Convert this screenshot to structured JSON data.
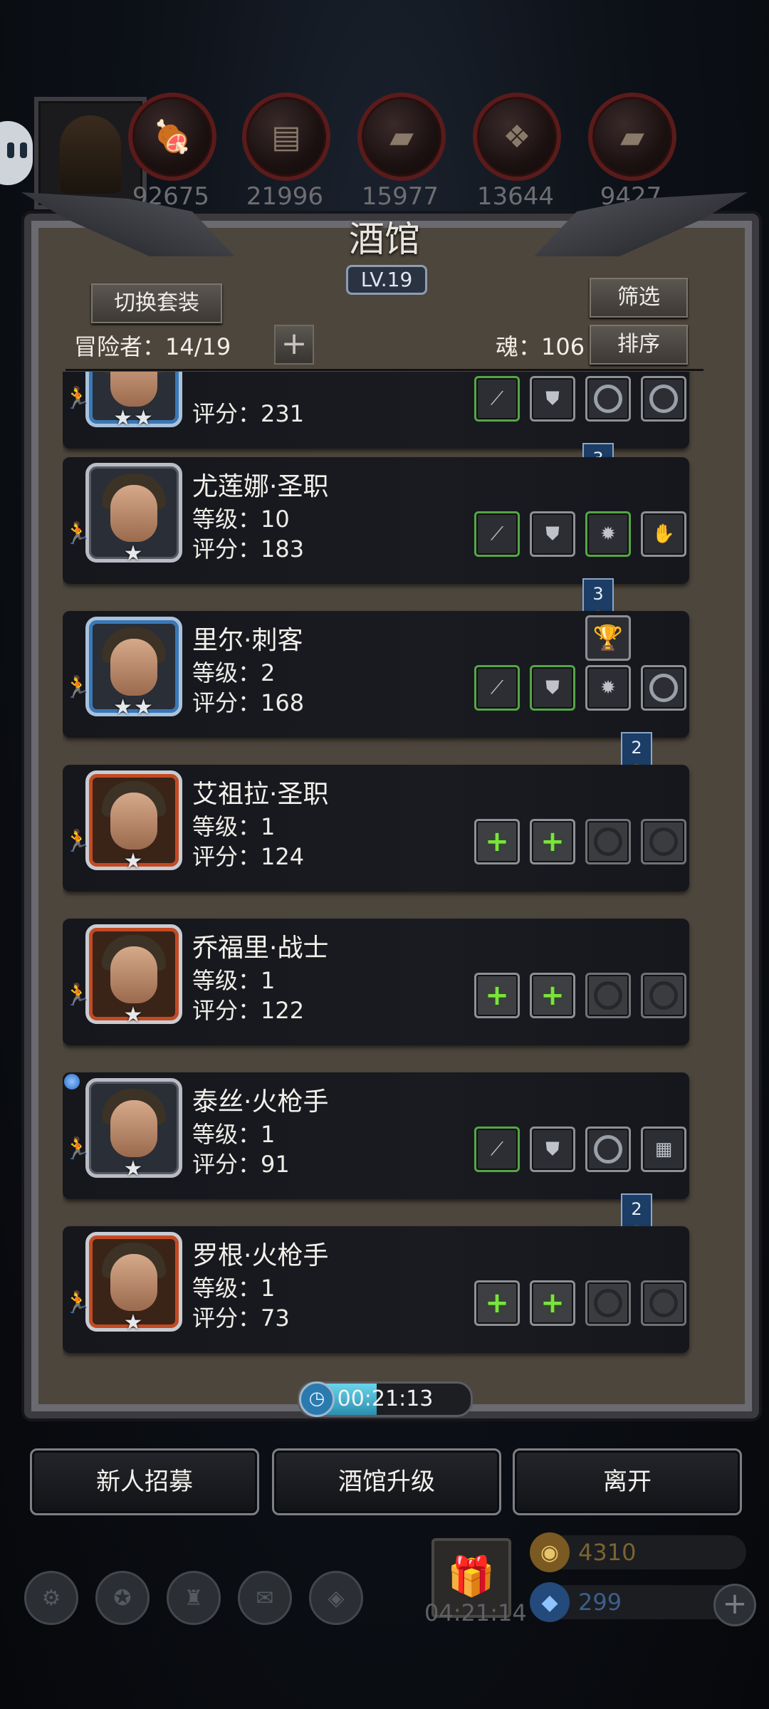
{
  "resources": [
    {
      "icon": "meat-icon",
      "value": "92675"
    },
    {
      "icon": "wood-icon",
      "value": "21996"
    },
    {
      "icon": "iron-ingot-icon",
      "value": "15977"
    },
    {
      "icon": "crystal-icon",
      "value": "13644"
    },
    {
      "icon": "steel-ingot-icon",
      "value": "9427"
    }
  ],
  "panel": {
    "title": "酒馆",
    "level": "LV.19",
    "switch_outfit_label": "切换套装",
    "filter_label": "筛选",
    "sort_label": "排序",
    "adventurers_label": "冒险者：14/19",
    "soul_label": "魂：106",
    "add_label": "+"
  },
  "heroes": [
    {
      "name": "",
      "level": "",
      "score": "评分：231",
      "stars": "★★",
      "frame": "blue",
      "slots": [
        {
          "t": "weapon",
          "g": true
        },
        {
          "t": "armor"
        },
        {
          "t": "ring"
        },
        {
          "t": "ring"
        }
      ],
      "flag": "3"
    },
    {
      "name": "尤莲娜·圣职",
      "level": "等级：10",
      "score": "评分：183",
      "stars": "★",
      "frame": "silver",
      "slots": [
        {
          "t": "weapon",
          "g": true
        },
        {
          "t": "armor"
        },
        {
          "t": "amulet",
          "g": true
        },
        {
          "t": "gauntlet"
        }
      ],
      "flag": "3"
    },
    {
      "name": "里尔·刺客",
      "level": "等级：2",
      "score": "评分：168",
      "stars": "★★",
      "frame": "blue",
      "slots": [
        {
          "t": "weapon",
          "g": true
        },
        {
          "t": "armor",
          "g": true
        },
        {
          "t": "amulet"
        },
        {
          "t": "ring"
        }
      ],
      "flag": "2",
      "trophy": true
    },
    {
      "name": "艾祖拉·圣职",
      "level": "等级：1",
      "score": "评分：124",
      "stars": "★",
      "frame": "orange",
      "slots": [
        {
          "t": "plus"
        },
        {
          "t": "plus"
        },
        {
          "t": "empty"
        },
        {
          "t": "empty"
        }
      ]
    },
    {
      "name": "乔福里·战士",
      "level": "等级：1",
      "score": "评分：122",
      "stars": "★",
      "frame": "orange",
      "slots": [
        {
          "t": "plus"
        },
        {
          "t": "plus"
        },
        {
          "t": "empty"
        },
        {
          "t": "empty"
        }
      ]
    },
    {
      "name": "泰丝·火枪手",
      "level": "等级：1",
      "score": "评分：91",
      "stars": "★",
      "frame": "silver",
      "slots": [
        {
          "t": "weapon",
          "g": true
        },
        {
          "t": "armor"
        },
        {
          "t": "ring"
        },
        {
          "t": "chest"
        }
      ],
      "flag": "2",
      "dot": true
    },
    {
      "name": "罗根·火枪手",
      "level": "等级：1",
      "score": "评分：73",
      "stars": "★",
      "frame": "orange",
      "slots": [
        {
          "t": "plus"
        },
        {
          "t": "plus"
        },
        {
          "t": "empty"
        },
        {
          "t": "empty"
        }
      ]
    }
  ],
  "timer": {
    "text": "00:21:13",
    "progress": 0.45
  },
  "buttons": {
    "recruit": "新人招募",
    "upgrade": "酒馆升级",
    "leave": "离开"
  },
  "bottom": {
    "gift_time": "04:21:14",
    "gold": "4310",
    "gems": "299",
    "menu_icons": [
      "settings-icon",
      "star-badge-icon",
      "fortress-icon",
      "mail-icon",
      "bag-icon"
    ]
  }
}
